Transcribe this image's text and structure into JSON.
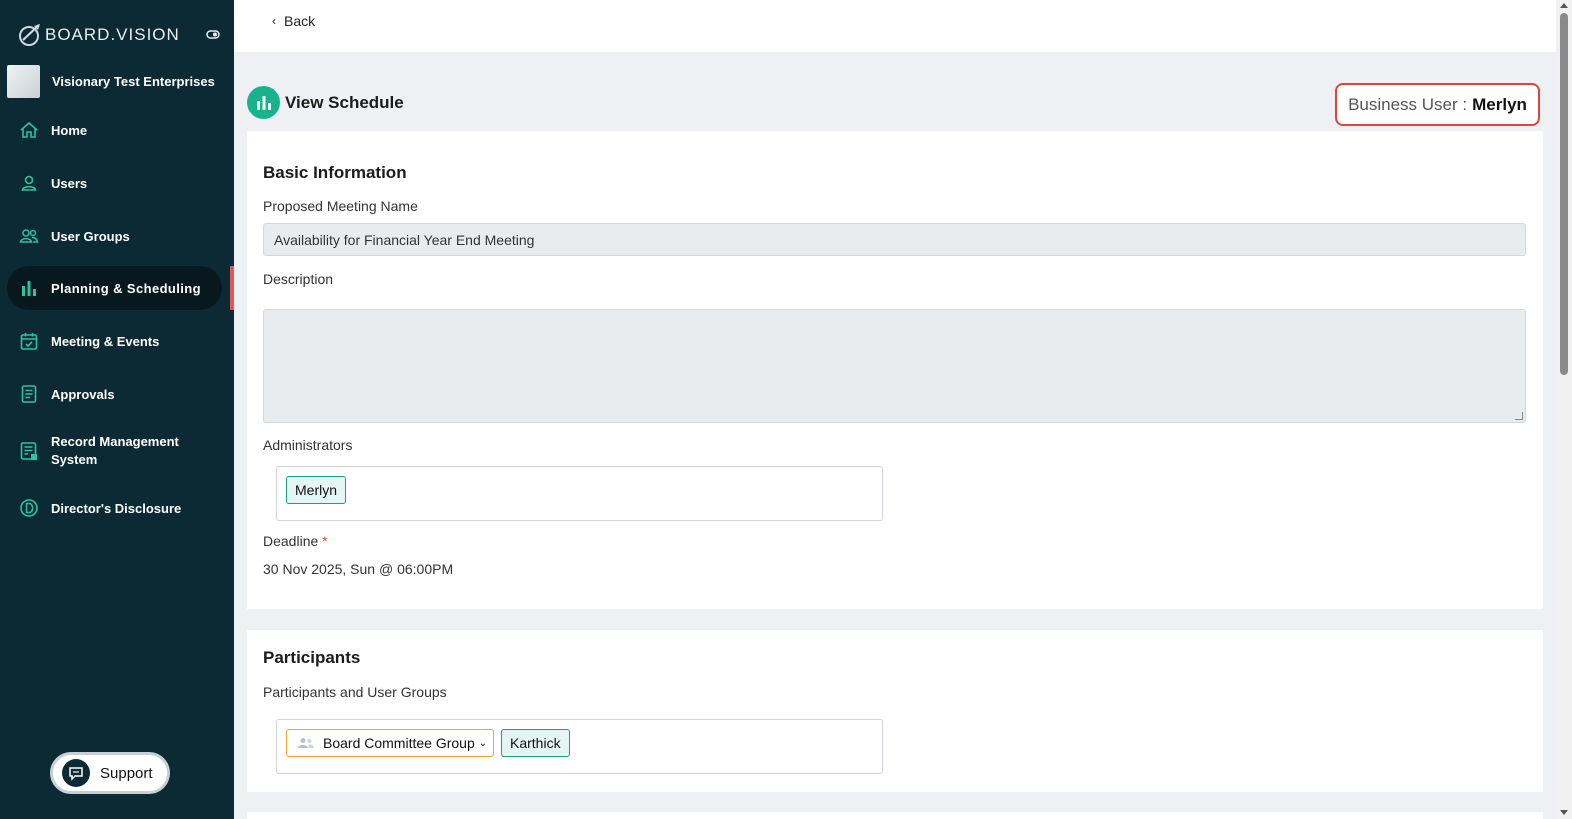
{
  "brand": {
    "name": "BOARD.VISION"
  },
  "organization": {
    "name": "Visionary Test Enterprises"
  },
  "sidebar": {
    "items": [
      {
        "label": "Home",
        "icon": "home-icon"
      },
      {
        "label": "Users",
        "icon": "user-icon"
      },
      {
        "label": "User Groups",
        "icon": "users-icon"
      },
      {
        "label": "Planning & Scheduling",
        "icon": "bar-chart-icon",
        "active": true
      },
      {
        "label": "Meeting & Events",
        "icon": "calendar-icon"
      },
      {
        "label": "Approvals",
        "icon": "document-icon"
      },
      {
        "label": "Record Management System",
        "icon": "record-icon"
      },
      {
        "label": "Director's Disclosure",
        "icon": "disclosure-d-icon"
      }
    ],
    "support_label": "Support"
  },
  "topbar": {
    "back_label": "Back"
  },
  "header": {
    "title": "View Schedule",
    "business_user_label": "Business User :",
    "business_user_name": "Merlyn"
  },
  "basic_info": {
    "title": "Basic Information",
    "meeting_name_label": "Proposed Meeting Name",
    "meeting_name_value": "Availability for Financial Year End Meeting",
    "description_label": "Description",
    "description_value": "",
    "administrators_label": "Administrators",
    "administrators": [
      "Merlyn"
    ],
    "deadline_label": "Deadline",
    "deadline_required_mark": "*",
    "deadline_value": "30 Nov 2025, Sun @ 06:00PM"
  },
  "participants": {
    "title": "Participants",
    "field_label": "Participants and User Groups",
    "group_chip": "Board Committee Group",
    "user_chip": "Karthick"
  },
  "colors": {
    "sidebar_bg": "#0b2a33",
    "accent_teal": "#19b28e",
    "highlight_red": "#d9473a",
    "group_chip_border": "#f0a531"
  }
}
